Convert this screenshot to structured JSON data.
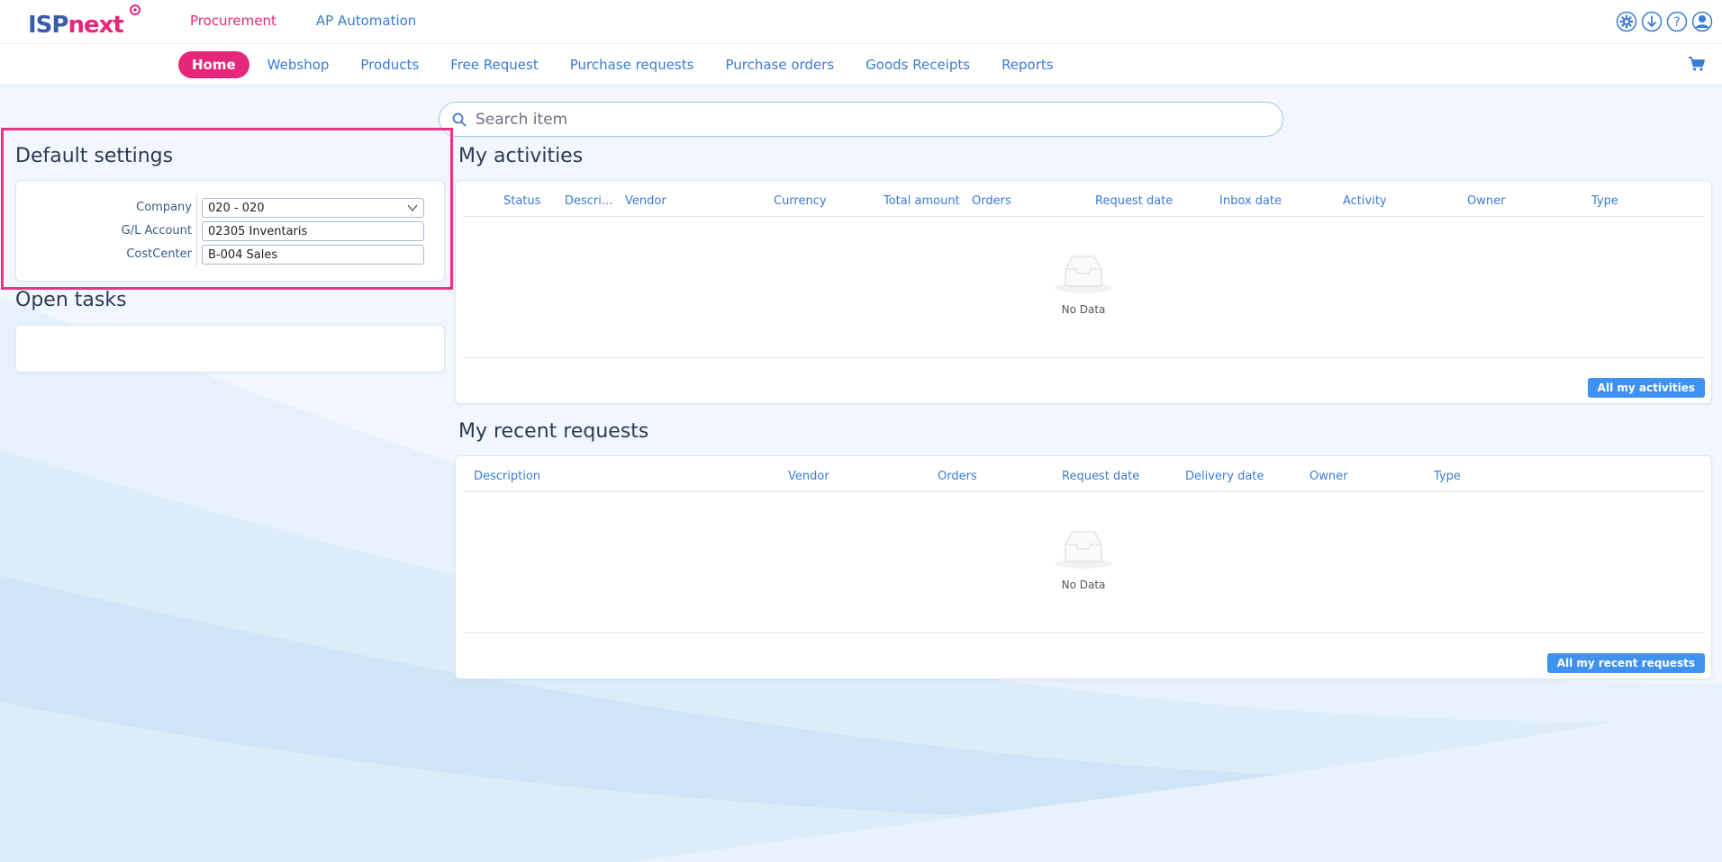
{
  "brand": {
    "logo_part1": "ISP",
    "logo_part2": "next",
    "primary_color": "#e6267a",
    "accent_color": "#3a7bd5"
  },
  "app_tabs": [
    {
      "label": "Procurement",
      "active": true
    },
    {
      "label": "AP Automation",
      "active": false
    }
  ],
  "top_icons": [
    "settings-gear-icon",
    "download-icon",
    "help-icon",
    "user-icon"
  ],
  "nav": {
    "items": [
      "Home",
      "Webshop",
      "Products",
      "Free Request",
      "Purchase requests",
      "Purchase orders",
      "Goods Receipts",
      "Reports"
    ],
    "active": "Home",
    "cart_icon": "shopping-cart-icon"
  },
  "search": {
    "placeholder": "Search item"
  },
  "default_settings": {
    "title": "Default settings",
    "company_label": "Company",
    "company_value": "020 - 020",
    "gl_label": "G/L Account",
    "gl_value": "02305 Inventaris",
    "cost_label": "CostCenter",
    "cost_value": "B-004 Sales"
  },
  "open_tasks": {
    "title": "Open tasks"
  },
  "my_activities": {
    "title": "My activities",
    "columns": [
      "Status",
      "Descri...",
      "Vendor",
      "Currency",
      "Total amount",
      "Orders",
      "Request date",
      "Inbox date",
      "Activity",
      "Owner",
      "Type"
    ],
    "empty_text": "No Data",
    "button": "All my activities"
  },
  "my_recent_requests": {
    "title": "My recent requests",
    "columns": [
      "Description",
      "Vendor",
      "Orders",
      "Request date",
      "Delivery date",
      "Owner",
      "Type"
    ],
    "empty_text": "No Data",
    "button": "All my recent requests"
  }
}
